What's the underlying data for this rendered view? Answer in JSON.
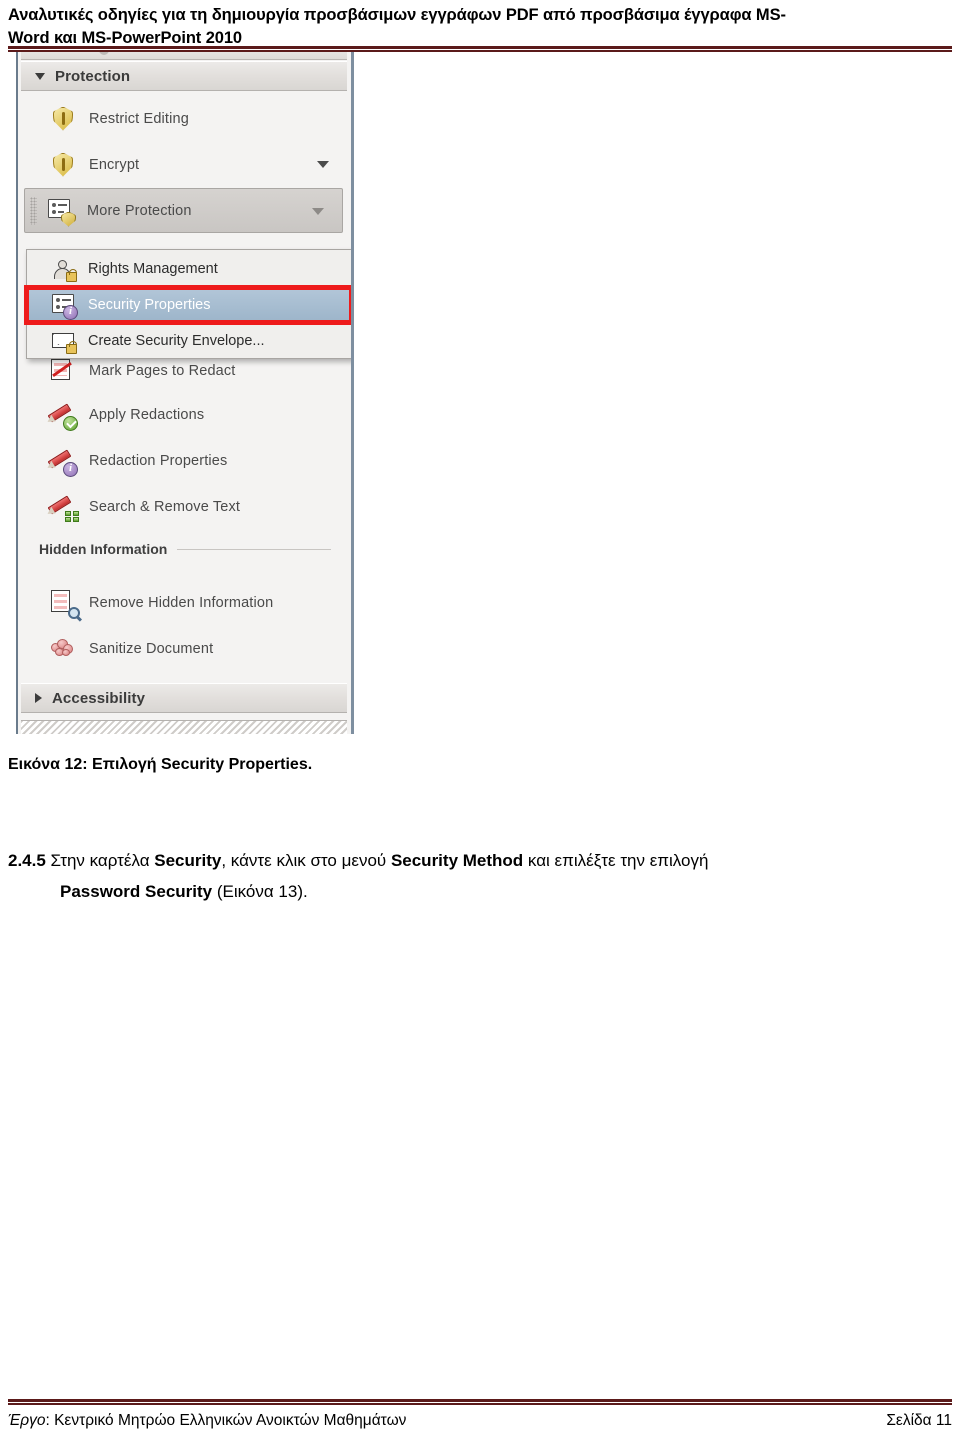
{
  "header": {
    "line1": "Αναλυτικές οδηγίες για τη δημιουργία προσβάσιμων εγγράφων PDF από προσβάσιμα έγγραφα MS-",
    "line2": "Word και MS-PowerPoint 2010"
  },
  "figure": {
    "sections": [
      {
        "label": "Protection",
        "expanded_icon": "chevron-down-icon"
      },
      {
        "label": "Accessibility",
        "expanded_icon": "chevron-right-icon"
      }
    ],
    "protection_items": [
      {
        "label": "Restrict Editing",
        "icon": "shield-icon",
        "has_caret": false
      },
      {
        "label": "Encrypt",
        "icon": "shield-icon",
        "has_caret": true
      },
      {
        "label": "More Protection",
        "icon": "document-shield-icon",
        "has_caret": true,
        "state": "pressed"
      }
    ],
    "obscured_item": {
      "label": "Mark Pages to Redact",
      "icon": "redact-page-icon"
    },
    "redaction_items": [
      {
        "label": "Apply Redactions",
        "icon": "pencil-check-icon"
      },
      {
        "label": "Redaction Properties",
        "icon": "pencil-info-icon"
      },
      {
        "label": "Search & Remove Text",
        "icon": "pencil-grid-icon"
      }
    ],
    "group_label": "Hidden Information",
    "hidden_items": [
      {
        "label": "Remove Hidden Information",
        "icon": "document-magnifier-icon"
      },
      {
        "label": "Sanitize Document",
        "icon": "sanitize-blob-icon"
      }
    ],
    "flyout": {
      "items": [
        {
          "label": "Rights Management",
          "icon": "person-lock-icon",
          "selected": false
        },
        {
          "label": "Security Properties",
          "icon": "document-info-icon",
          "selected": true
        },
        {
          "label": "Create Security Envelope...",
          "icon": "envelope-lock-icon",
          "selected": false
        }
      ]
    },
    "annotation": {
      "type": "red-highlight-box",
      "color": "#ee1b1b",
      "target": "Security Properties"
    }
  },
  "caption": "Εικόνα 12: Επιλογή Security Properties.",
  "paragraph": {
    "number": "2.4.5",
    "line1_a": " Στην καρτέλα ",
    "line1_b_bold": "Security",
    "line1_c": ", κάντε κλικ στο μενού ",
    "line1_d_bold": "Security Method",
    "line1_e": " και επιλέξτε την επιλογή",
    "line2_a_bold": "Password Security",
    "line2_b": " (Εικόνα 13)."
  },
  "footer": {
    "left_italic": "Έργο",
    "left_rest": ": Κεντρικό Μητρώο Ελληνικών Ανοικτών Μαθημάτων",
    "right": "Σελίδα 11"
  },
  "colors": {
    "rule": "#5b1a1a",
    "annotation": "#ee1b1b",
    "selection": "#9db5ca",
    "panel_bg": "#f4f3f2"
  }
}
